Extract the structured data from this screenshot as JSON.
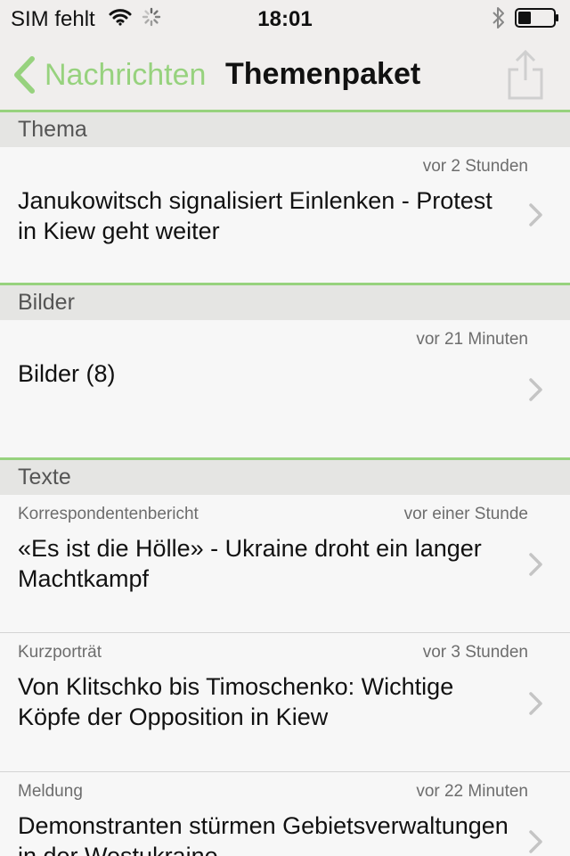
{
  "status_bar": {
    "carrier": "SIM fehlt",
    "time": "18:01"
  },
  "nav": {
    "back_label": "Nachrichten",
    "title": "Themenpaket"
  },
  "colors": {
    "accent": "#97d27e",
    "header_background": "#f0eeed",
    "section_background": "#e5e5e3"
  },
  "sections": [
    {
      "header": "Thema",
      "items": [
        {
          "category": "",
          "time": "vor 2 Stunden",
          "title": "Janukowitsch signalisiert Einlenken - Protest in Kiew geht weiter"
        }
      ]
    },
    {
      "header": "Bilder",
      "items": [
        {
          "category": "",
          "time": "vor 21 Minuten",
          "title": "Bilder (8)"
        }
      ]
    },
    {
      "header": "Texte",
      "items": [
        {
          "category": "Korrespondentenbericht",
          "time": "vor einer Stunde",
          "title": "«Es ist die Hölle» - Ukraine droht ein langer Machtkampf"
        },
        {
          "category": "Kurzporträt",
          "time": "vor 3 Stunden",
          "title": "Von Klitschko bis Timoschenko: Wichtige Köpfe der Opposition in Kiew"
        },
        {
          "category": "Meldung",
          "time": "vor 22 Minuten",
          "title": "Demonstranten stürmen Gebietsverwaltungen in der Westukraine"
        }
      ]
    }
  ]
}
